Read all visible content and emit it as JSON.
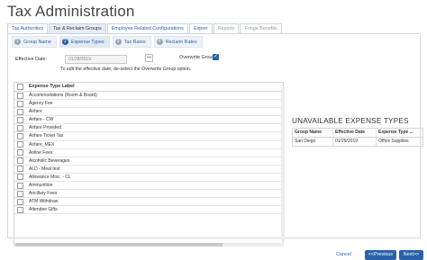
{
  "page_title": "Tax Administration",
  "tabs": [
    {
      "label": "Tax Authorities",
      "state": "normal"
    },
    {
      "label": "Tax & Reclaim Groups",
      "state": "active"
    },
    {
      "label": "Employee Related Configurations",
      "state": "normal"
    },
    {
      "label": "Export",
      "state": "normal"
    },
    {
      "label": "Reports",
      "state": "disabled"
    },
    {
      "label": "Fringe Benefits",
      "state": "disabled"
    }
  ],
  "steps": [
    {
      "num": "1",
      "label": "Group Name"
    },
    {
      "num": "2",
      "label": "Expense Types"
    },
    {
      "num": "3",
      "label": "Tax Rates"
    },
    {
      "num": "4",
      "label": "Reclaim Rates"
    }
  ],
  "effective_date": {
    "label": "Effective Date:",
    "value": "01/28/2019"
  },
  "overwrite": {
    "label": "Overwrite Group:",
    "checked": true
  },
  "hint": "To edit the effective date, de-select the Overwrite Group option.",
  "expense_table": {
    "header": "Expense Type Label",
    "rows": [
      "Accommodations (Room & Board)",
      "Agency Fee",
      "Airfare",
      "Airfare - CW",
      "Airfare Provided",
      "Airfare Ticket Tax",
      "Airfare_MEX",
      "Airline Fees",
      "Alcoholic Beverages",
      "ALD - Meal test",
      "Allowance Misc. - CL",
      "Ammunition",
      "Ancillary Fees",
      "ATM Withdraw",
      "Attendee Gifts"
    ]
  },
  "unavailable": {
    "title": "UNAVAILABLE EXPENSE TYPES",
    "headers": [
      "Group Name",
      "Effective Date",
      "Expense Type ..."
    ],
    "rows": [
      [
        "San Diego",
        "01/29/2019",
        "Office Supplies"
      ]
    ]
  },
  "buttons": {
    "cancel": "Cancel",
    "previous": "<<Previous",
    "next": "Next>>"
  },
  "colors": {
    "accent": "#2a62a8"
  }
}
